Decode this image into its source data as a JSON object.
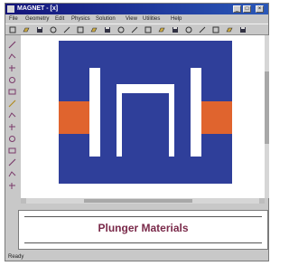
{
  "window": {
    "title": "MAGNET - [x]",
    "buttons": {
      "minimize": "_",
      "maximize": "□",
      "close": "×"
    }
  },
  "menu": [
    "File",
    "Geometry",
    "Edit",
    "Physics",
    "Solution",
    "View",
    "Utilities",
    "Help"
  ],
  "toolbar_icons": [
    "new-icon",
    "open-icon",
    "save-icon",
    "print-icon",
    "zoom-icon",
    "select-icon",
    "pan-icon",
    "line-icon",
    "arc-icon",
    "polyline-icon",
    "circle-icon",
    "rectangle-icon",
    "mesh-icon",
    "solve-icon",
    "plot-icon",
    "field-icon",
    "window-icon",
    "help-icon"
  ],
  "left_tools": [
    "select-tool-icon",
    "line-tool-icon",
    "move-tool-icon",
    "rotate-tool-icon",
    "circle-tool-icon",
    "polygon-tool-icon",
    "node-tool-icon",
    "triangle-tool-icon",
    "edge-tool-icon",
    "fill-tool-icon",
    "copy-tool-icon",
    "delete-tool-icon",
    "text-tool-icon"
  ],
  "colors": {
    "steel": "#2f3f9a",
    "coil": "#e0642e",
    "background": "#ffffff",
    "caption": "#7a2a4a"
  },
  "panel": {
    "caption": "Plunger Materials"
  },
  "status": {
    "text": "Ready"
  }
}
